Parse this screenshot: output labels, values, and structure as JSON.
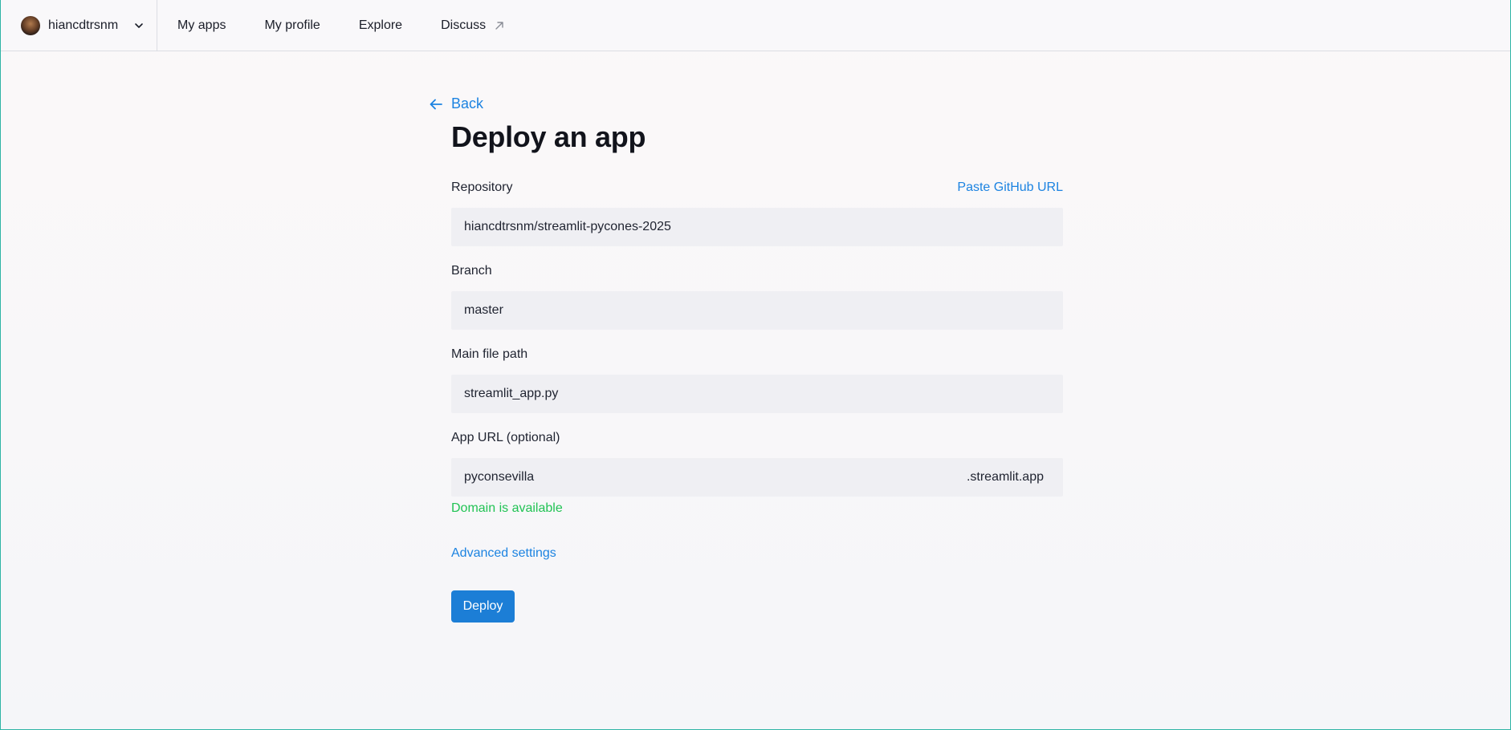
{
  "header": {
    "account_name": "hiancdtrsnm",
    "nav": [
      "My apps",
      "My profile",
      "Explore",
      "Discuss"
    ]
  },
  "main": {
    "back_label": "Back",
    "title": "Deploy an app",
    "repository": {
      "label": "Repository",
      "link": "Paste GitHub URL",
      "value": "hiancdtrsnm/streamlit-pycones-2025"
    },
    "branch": {
      "label": "Branch",
      "value": "master"
    },
    "main_file": {
      "label": "Main file path",
      "value": "streamlit_app.py"
    },
    "app_url": {
      "label": "App URL (optional)",
      "value": "pyconsevilla",
      "suffix": ".streamlit.app",
      "status": "Domain is available"
    },
    "advanced_label": "Advanced settings",
    "deploy_label": "Deploy"
  },
  "colors": {
    "accent": "#1c83e1",
    "button": "#1c7ed6",
    "success": "#21c354",
    "input_bg": "#efeff3"
  },
  "icons": {
    "back": "arrow-left-icon",
    "account_menu": "chevron-down-icon",
    "external": "external-link-arrow-icon"
  }
}
